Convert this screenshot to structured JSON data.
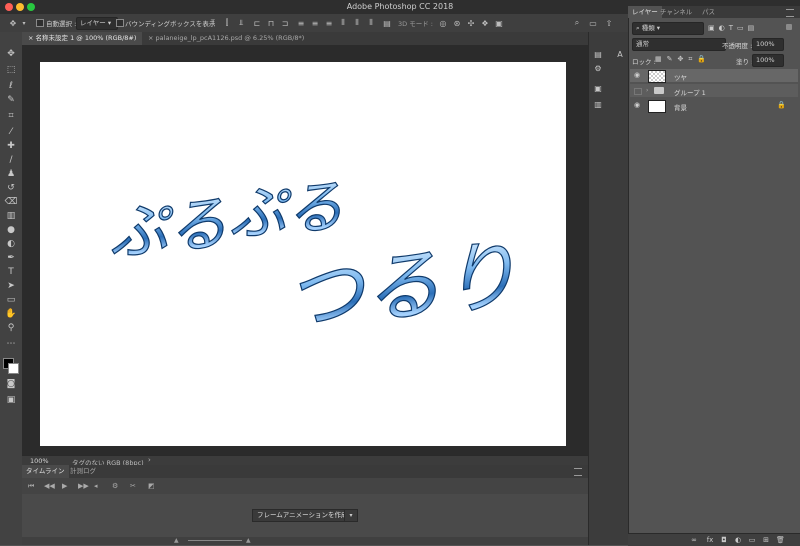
{
  "app": {
    "title": "Adobe Photoshop CC 2018"
  },
  "options_bar": {
    "auto_select_label": "自動選択 :",
    "auto_select_value": "レイヤー",
    "bbox_label": "バウンディングボックスを表示",
    "mode_3d": "3D モード :"
  },
  "tabs": [
    {
      "label": "名称未設定 1 @ 100% (RGB/8#)",
      "close": "×",
      "active": true
    },
    {
      "label": "palaneige_lp_pcA1126.psd @ 6.25% (RGB/8*)",
      "close": "×",
      "active": false
    }
  ],
  "canvas": {
    "text_line1": "ぷる",
    "text_line2": "ぷる",
    "text_line3": "つるり"
  },
  "status": {
    "zoom": "100%",
    "profile": "タグのない RGB (8bpc)",
    "arrow": "›"
  },
  "timeline": {
    "tab_timeline": "タイムライン",
    "tab_log": "計測ログ",
    "create_button": "フレームアニメーションを作成"
  },
  "layers_panel": {
    "tabs": [
      "レイヤー",
      "チャンネル",
      "パス"
    ],
    "filter_label": "種類",
    "blend_mode": "通常",
    "opacity_label": "不透明度 :",
    "opacity_value": "100%",
    "lock_label": "ロック :",
    "fill_label": "塗り :",
    "fill_value": "100%",
    "layers": [
      {
        "name": "ツヤ",
        "type": "pixel-transparent",
        "visible": true
      },
      {
        "name": "グループ 1",
        "type": "group",
        "visible": false
      },
      {
        "name": "背景",
        "type": "background",
        "visible": true,
        "locked": true
      }
    ]
  },
  "colors": {
    "text_gradient_top": "#9fd0ff",
    "text_gradient_mid": "#3f8fd9",
    "text_gradient_dark": "#1c4f8c",
    "accent_active_tab": "#4a4a4a"
  }
}
